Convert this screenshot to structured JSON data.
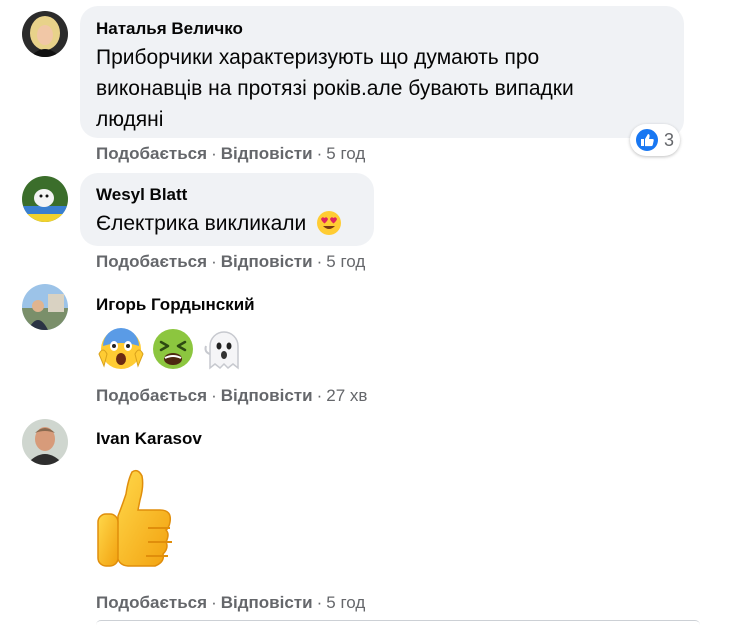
{
  "comments": [
    {
      "author": "Наталья Величко",
      "lines": [
        "Приборчики характеризують що думають про",
        "виконавців на протязі років.але бувають випадки",
        "людяні"
      ],
      "like_label": "Подобається",
      "reply_label": "Відповісти",
      "time": "5 год",
      "reaction_count": "3",
      "reaction_icon": "like-reaction-icon"
    },
    {
      "author": "Wesyl Blatt",
      "lines": [
        "Єлектрика викликали"
      ],
      "inline_emoji": "heart-eyes-emoji-icon",
      "like_label": "Подобається",
      "reply_label": "Відповісти",
      "time": "5 год"
    },
    {
      "author": "Игорь Гордынский",
      "stickers": [
        "screaming-face-emoji-icon",
        "nauseated-face-emoji-icon",
        "ghost-emoji-icon"
      ],
      "like_label": "Подобається",
      "reply_label": "Відповісти",
      "time": "27 хв"
    },
    {
      "author": "Ivan Karasov",
      "stickers": [
        "thumbs-up-emoji-icon"
      ],
      "like_label": "Подобається",
      "reply_label": "Відповісти",
      "time": "5 год"
    }
  ],
  "colors": {
    "bubble": "#f0f2f5",
    "meta_text": "#65676b",
    "like_blue": "#1877f2"
  }
}
